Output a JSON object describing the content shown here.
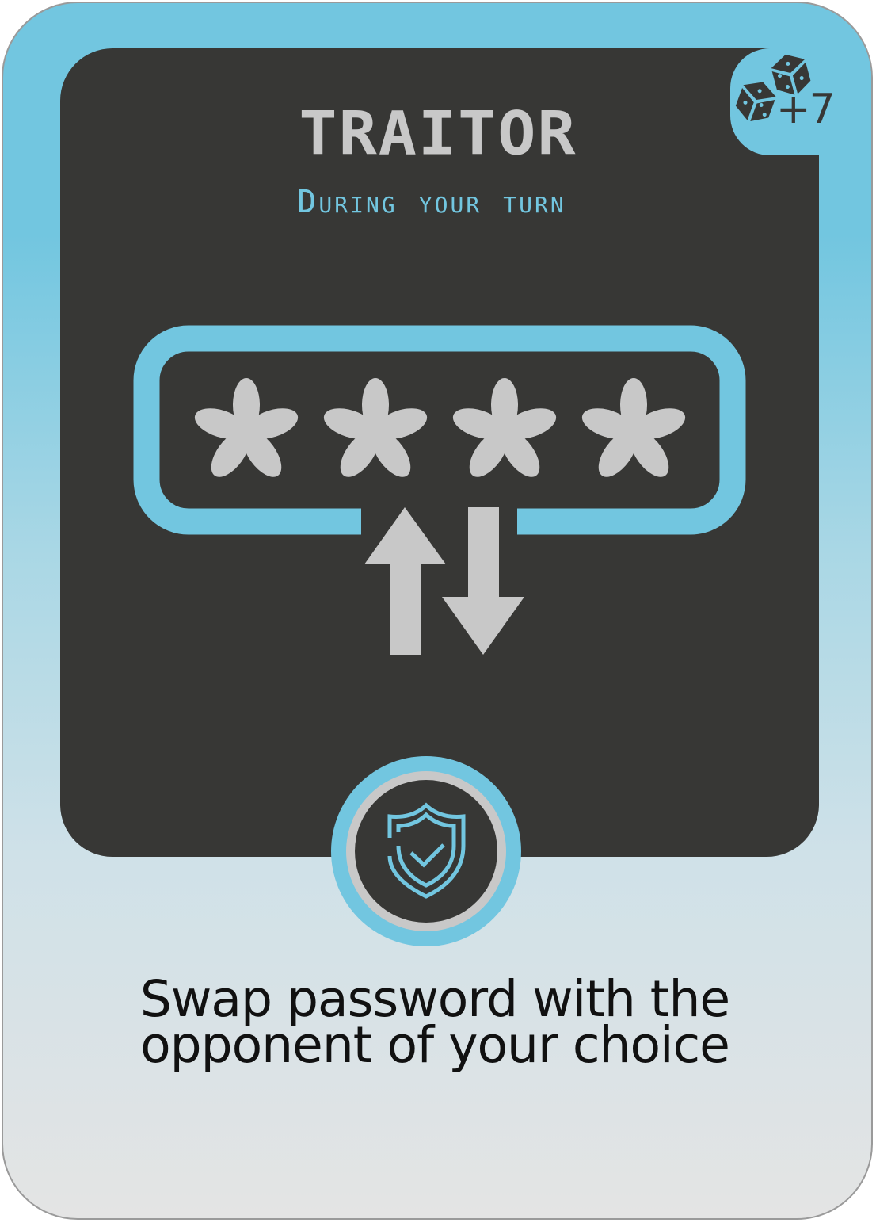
{
  "card": {
    "title": "TRAITOR",
    "timing": "During your turn",
    "cost": "+7",
    "cost_icon": "dice-icon",
    "illustration": "password-swap",
    "type_icon": "shield-check-icon",
    "description_line1": "Swap password with the",
    "description_line2": "opponent of your choice",
    "colors": {
      "accent": "#72c6e0",
      "panel": "#373735",
      "glyph": "#c8c8c8"
    }
  }
}
